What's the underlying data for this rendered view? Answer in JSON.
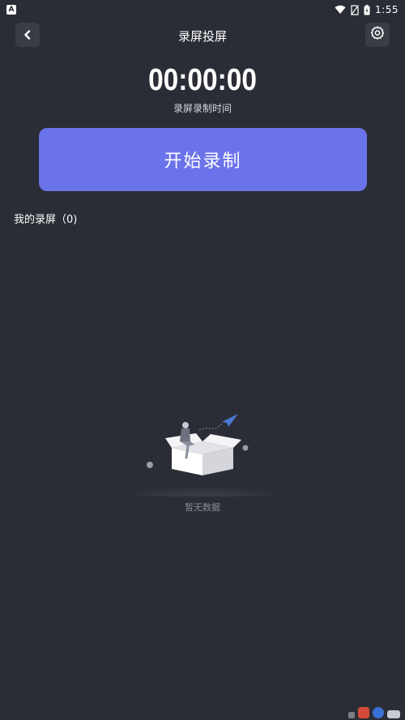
{
  "status_bar": {
    "notification_letter": "A",
    "time": "1:55"
  },
  "header": {
    "title": "录屏投屏"
  },
  "timer": {
    "value": "00:00:00",
    "caption": "录屏录制时间"
  },
  "record_button": {
    "label": "开始录制"
  },
  "recordings": {
    "title": "我的录屏（0)"
  },
  "empty_state": {
    "text": "暂无数据"
  },
  "colors": {
    "background": "#2b2d36",
    "accent": "#6b73ea",
    "icon_button_bg": "#3a3c46"
  }
}
